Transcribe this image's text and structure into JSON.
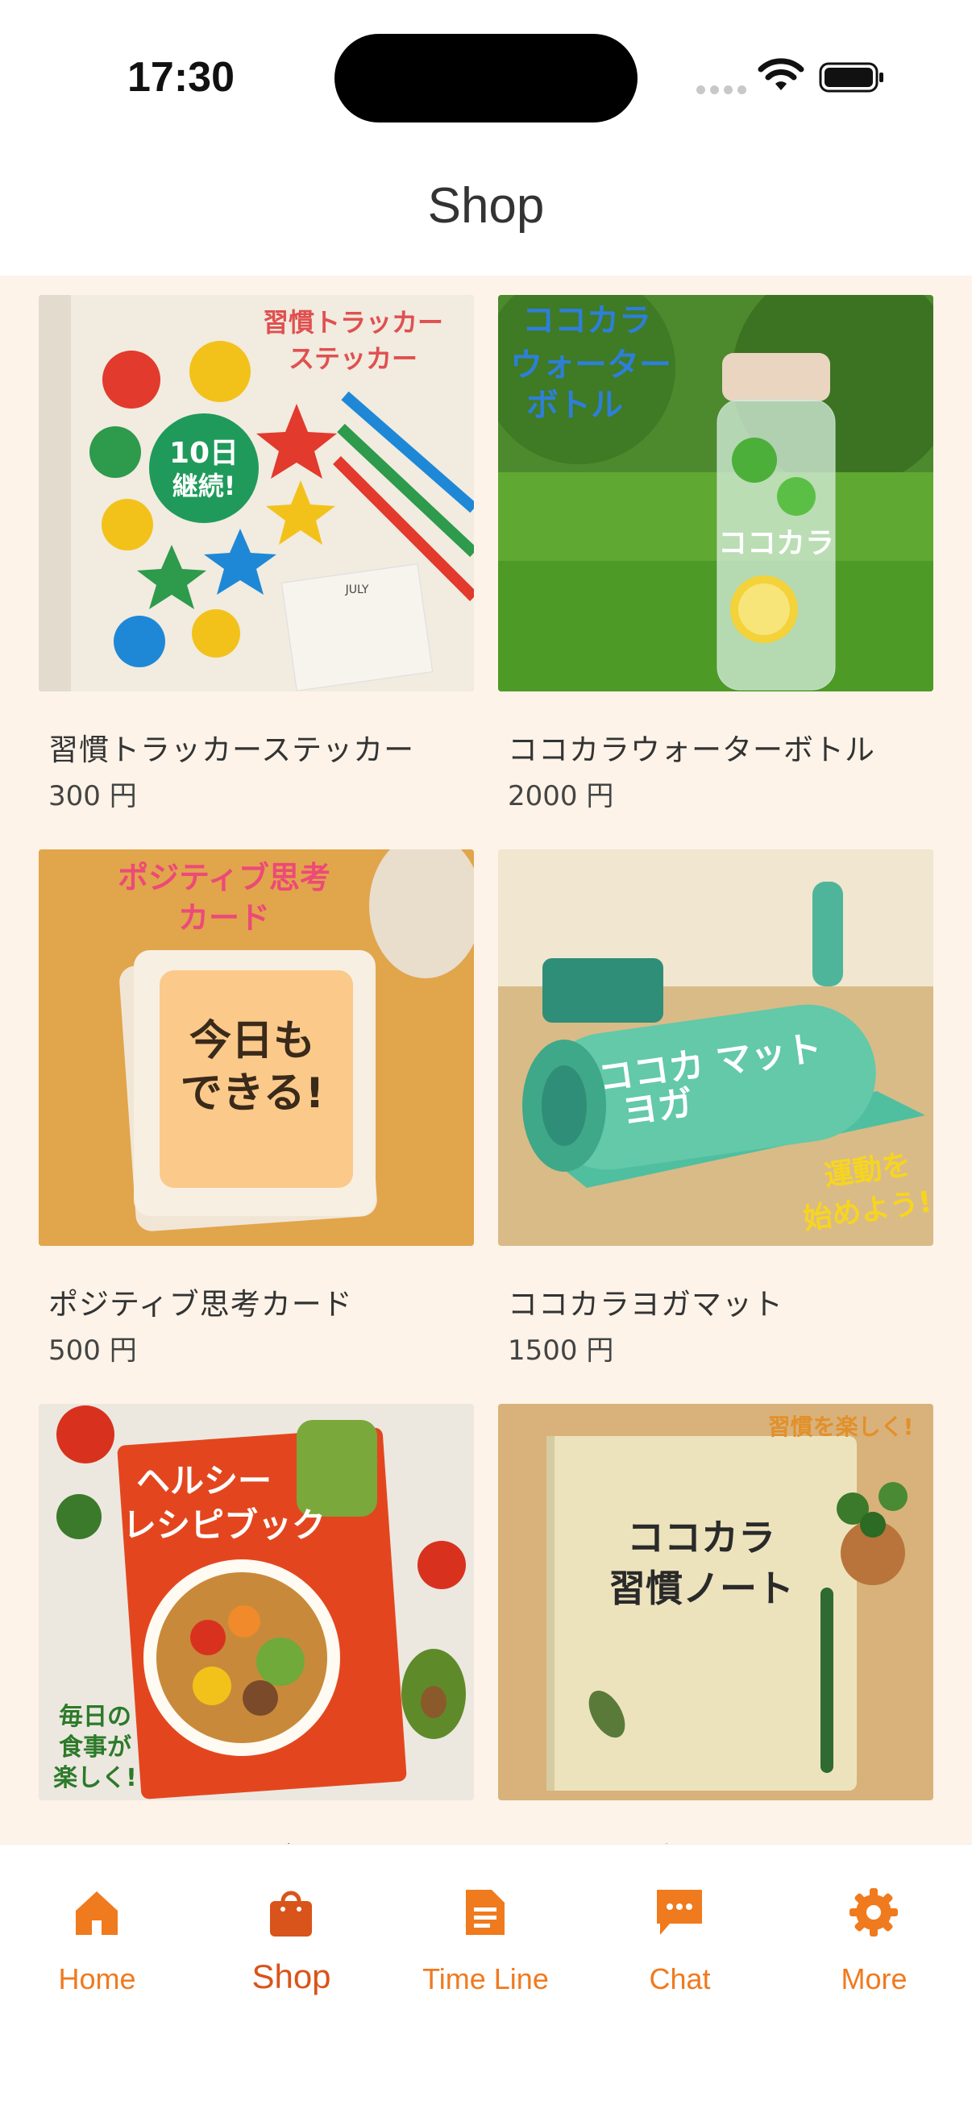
{
  "status_bar": {
    "time": "17:30"
  },
  "header": {
    "title": "Shop"
  },
  "products": [
    {
      "name": "習慣トラッカーステッカー",
      "price": "300 円",
      "image_text": [
        "習慣トラッカー",
        "ステッカー",
        "10日",
        "継続!",
        "JULY"
      ]
    },
    {
      "name": "ココカラウォーターボトル",
      "price": "2000 円",
      "image_text": [
        "ココカラ",
        "ウォーター",
        "ボトル",
        "ココカラ"
      ]
    },
    {
      "name": "ポジティブ思考カード",
      "price": "500 円",
      "image_text": [
        "ポジティブ思考",
        "カード",
        "今日も",
        "できる!"
      ]
    },
    {
      "name": "ココカラヨガマット",
      "price": "1500 円",
      "image_text": [
        "ココカ マット",
        "ヨガ",
        "運動を",
        "始めよう!"
      ]
    },
    {
      "name": "ヘルシーレシピブック",
      "price": "",
      "image_text": [
        "ヘルシー",
        "レシピブック",
        "毎日の",
        "食事が",
        "楽しく!"
      ]
    },
    {
      "name": "ココカラ習慣ノート",
      "price": "",
      "image_text": [
        "習慣を楽しく!",
        "ココカラ",
        "習慣ノート"
      ]
    }
  ],
  "tabs": [
    {
      "label": "Home",
      "icon": "home-icon"
    },
    {
      "label": "Shop",
      "icon": "shopping-bag-icon",
      "active": true
    },
    {
      "label": "Time Line",
      "icon": "document-icon"
    },
    {
      "label": "Chat",
      "icon": "chat-bubble-icon"
    },
    {
      "label": "More",
      "icon": "gear-icon"
    }
  ],
  "colors": {
    "accent": "#f07a1e",
    "active": "#d9541a",
    "background": "#fdf3e8"
  }
}
